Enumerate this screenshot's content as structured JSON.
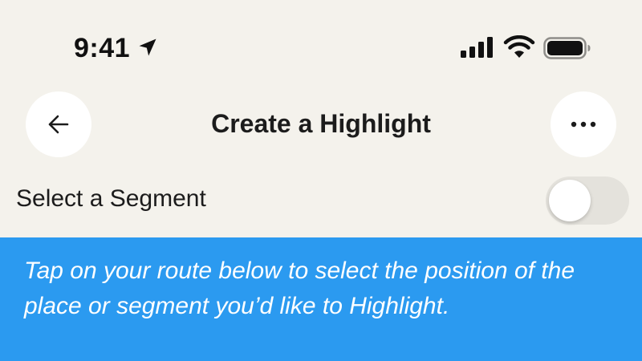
{
  "status_bar": {
    "time": "9:41",
    "icons": [
      "location-arrow-icon",
      "cellular-signal-icon",
      "wifi-icon",
      "battery-icon"
    ]
  },
  "header": {
    "title": "Create a Highlight",
    "back_icon": "arrow-left-icon",
    "more_icon": "ellipsis-icon"
  },
  "segment": {
    "label": "Select a Segment",
    "toggle_on": false
  },
  "info": {
    "text": "Tap on your route below to select the position of the place or segment you’d like to Highlight."
  },
  "colors": {
    "background": "#f4f2ec",
    "info_panel": "#2b9af0",
    "button_bg": "#ffffff",
    "toggle_track": "#e4e2dc"
  }
}
